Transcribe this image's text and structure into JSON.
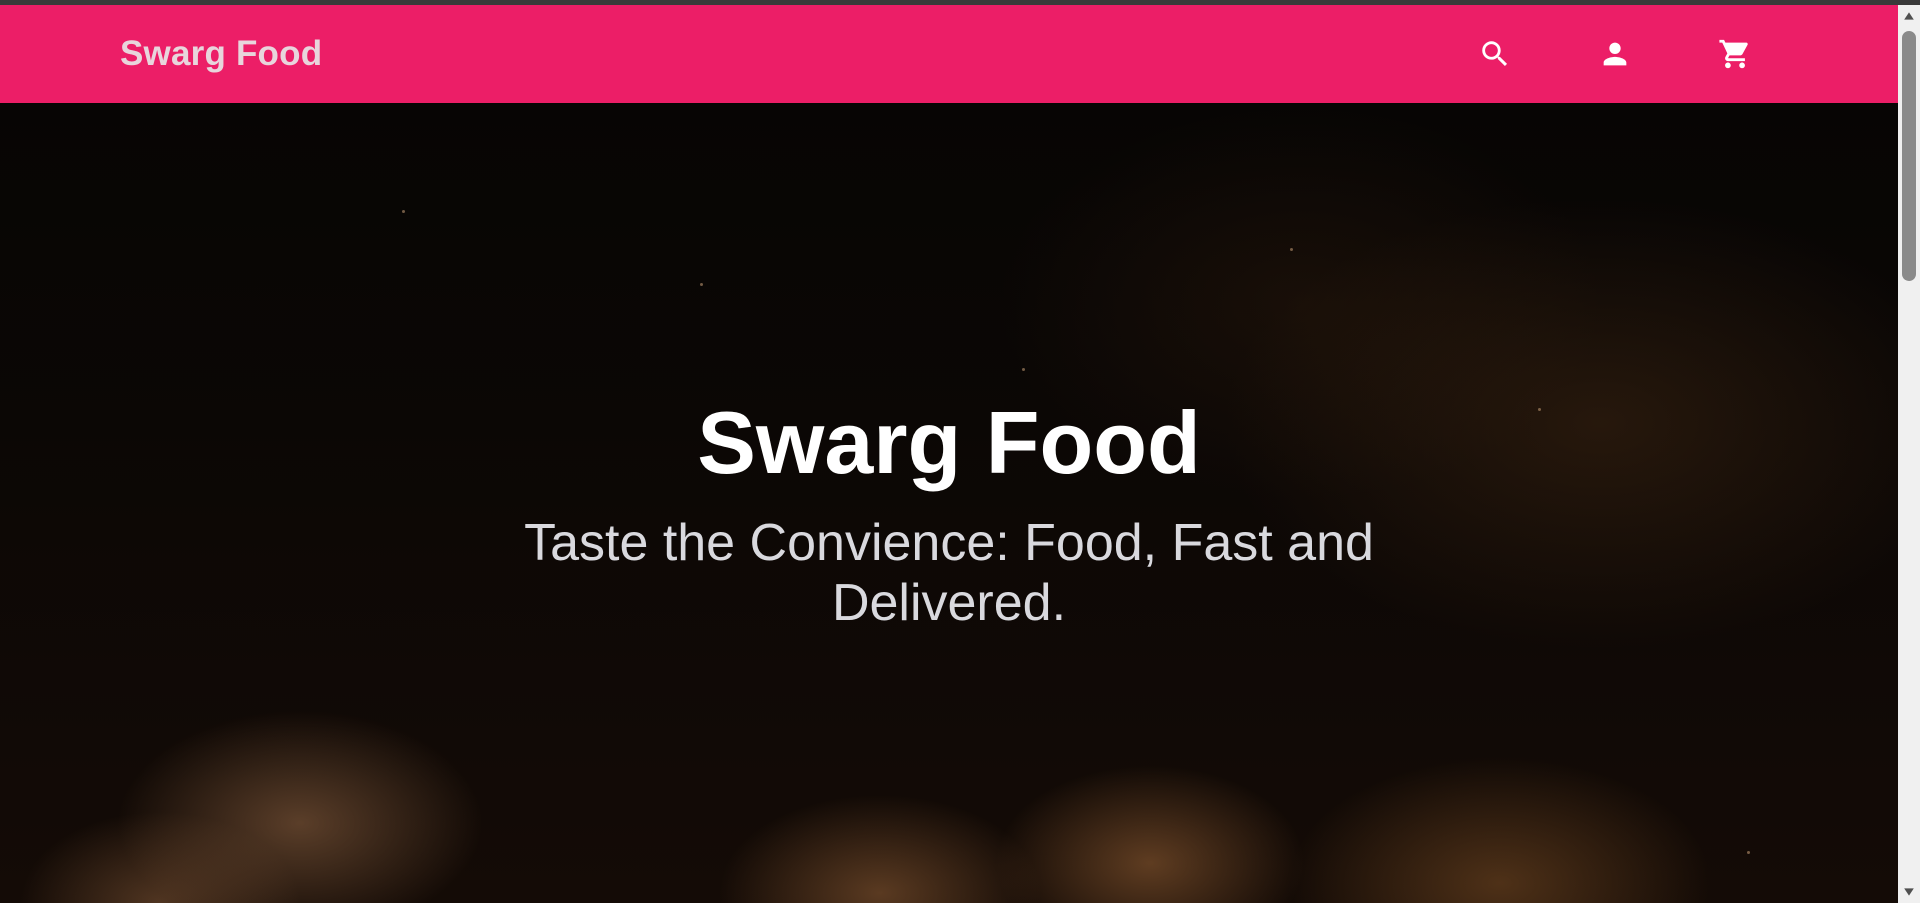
{
  "colors": {
    "nav_background": "#ec1e67",
    "brand_text": "#e8d5dc"
  },
  "navbar": {
    "brand": "Swarg Food",
    "icons": [
      "search-icon",
      "account-icon",
      "cart-icon"
    ]
  },
  "hero": {
    "title": "Swarg Food",
    "subtitle": "Taste the Convience: Food, Fast and Delivered."
  }
}
